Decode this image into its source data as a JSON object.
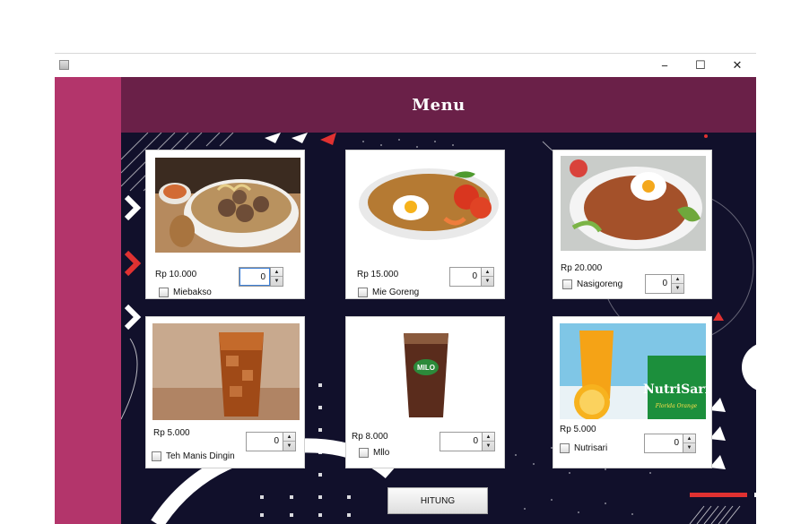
{
  "window": {
    "controls": {
      "minimize": "−",
      "maximize": "☐",
      "close": "✕"
    }
  },
  "header": {
    "title": "Menu"
  },
  "items": [
    {
      "price": "Rp 10.000",
      "qty": "0",
      "name": "Miebakso",
      "checked": false,
      "image": "meatball-soup-bowl"
    },
    {
      "price": "Rp 15.000",
      "qty": "0",
      "name": "Mie Goreng",
      "checked": false,
      "image": "fried-noodles-with-egg"
    },
    {
      "price": "Rp 20.000",
      "qty": "0",
      "name": "Nasigoreng",
      "checked": false,
      "image": "fried-rice-with-egg"
    },
    {
      "price": "Rp 5.000",
      "qty": "0",
      "name": "Teh Manis Dingin",
      "checked": false,
      "image": "iced-sweet-tea-glass"
    },
    {
      "price": "Rp 8.000",
      "qty": "0",
      "name": "Mllo",
      "checked": false,
      "image": "milo-iced-glass"
    },
    {
      "price": "Rp 5.000",
      "qty": "0",
      "name": "Nutrisari",
      "checked": false,
      "image": "orange-juice-nutrisari"
    }
  ],
  "nutrisari_pack": {
    "brand": "NutriSari",
    "flavor": "Florida Orange"
  },
  "milo_label": "MILO",
  "hitung_label": "HITUNG",
  "colors": {
    "sidebar": "#b3356b",
    "header": "#6a2048",
    "background": "#11102b",
    "accent_red": "#e03131"
  }
}
